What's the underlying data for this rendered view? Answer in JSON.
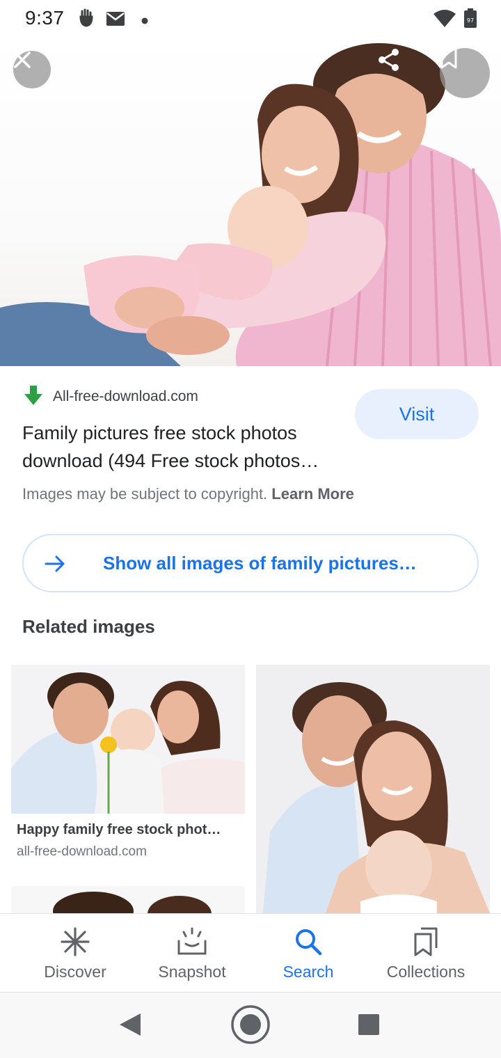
{
  "status_bar": {
    "time": "9:37",
    "battery_level": "97"
  },
  "hero": {
    "close_icon": "close-icon",
    "share_icon": "share-icon",
    "bookmark_icon": "bookmark-icon"
  },
  "result": {
    "source_name": "All-free-download.com",
    "title": "Family pictures free stock photos download (494 Free stock photos…",
    "visit_label": "Visit",
    "copyright_text": "Images may be subject to copyright.",
    "learn_more_label": "Learn More"
  },
  "show_all": {
    "label": "Show all images of family pictures…"
  },
  "related": {
    "heading": "Related images",
    "items": [
      {
        "caption": "Happy family free stock phot…",
        "source": "all-free-download.com"
      }
    ]
  },
  "bottom_nav": {
    "items": [
      {
        "label": "Discover",
        "icon": "asterisk-icon",
        "active": false
      },
      {
        "label": "Snapshot",
        "icon": "snapshot-icon",
        "active": false
      },
      {
        "label": "Search",
        "icon": "search-icon",
        "active": true
      },
      {
        "label": "Collections",
        "icon": "collections-icon",
        "active": false
      }
    ]
  },
  "colors": {
    "accent": "#1a73e8",
    "visit_bg": "#e8f0fe",
    "secondary_text": "#70757a"
  }
}
